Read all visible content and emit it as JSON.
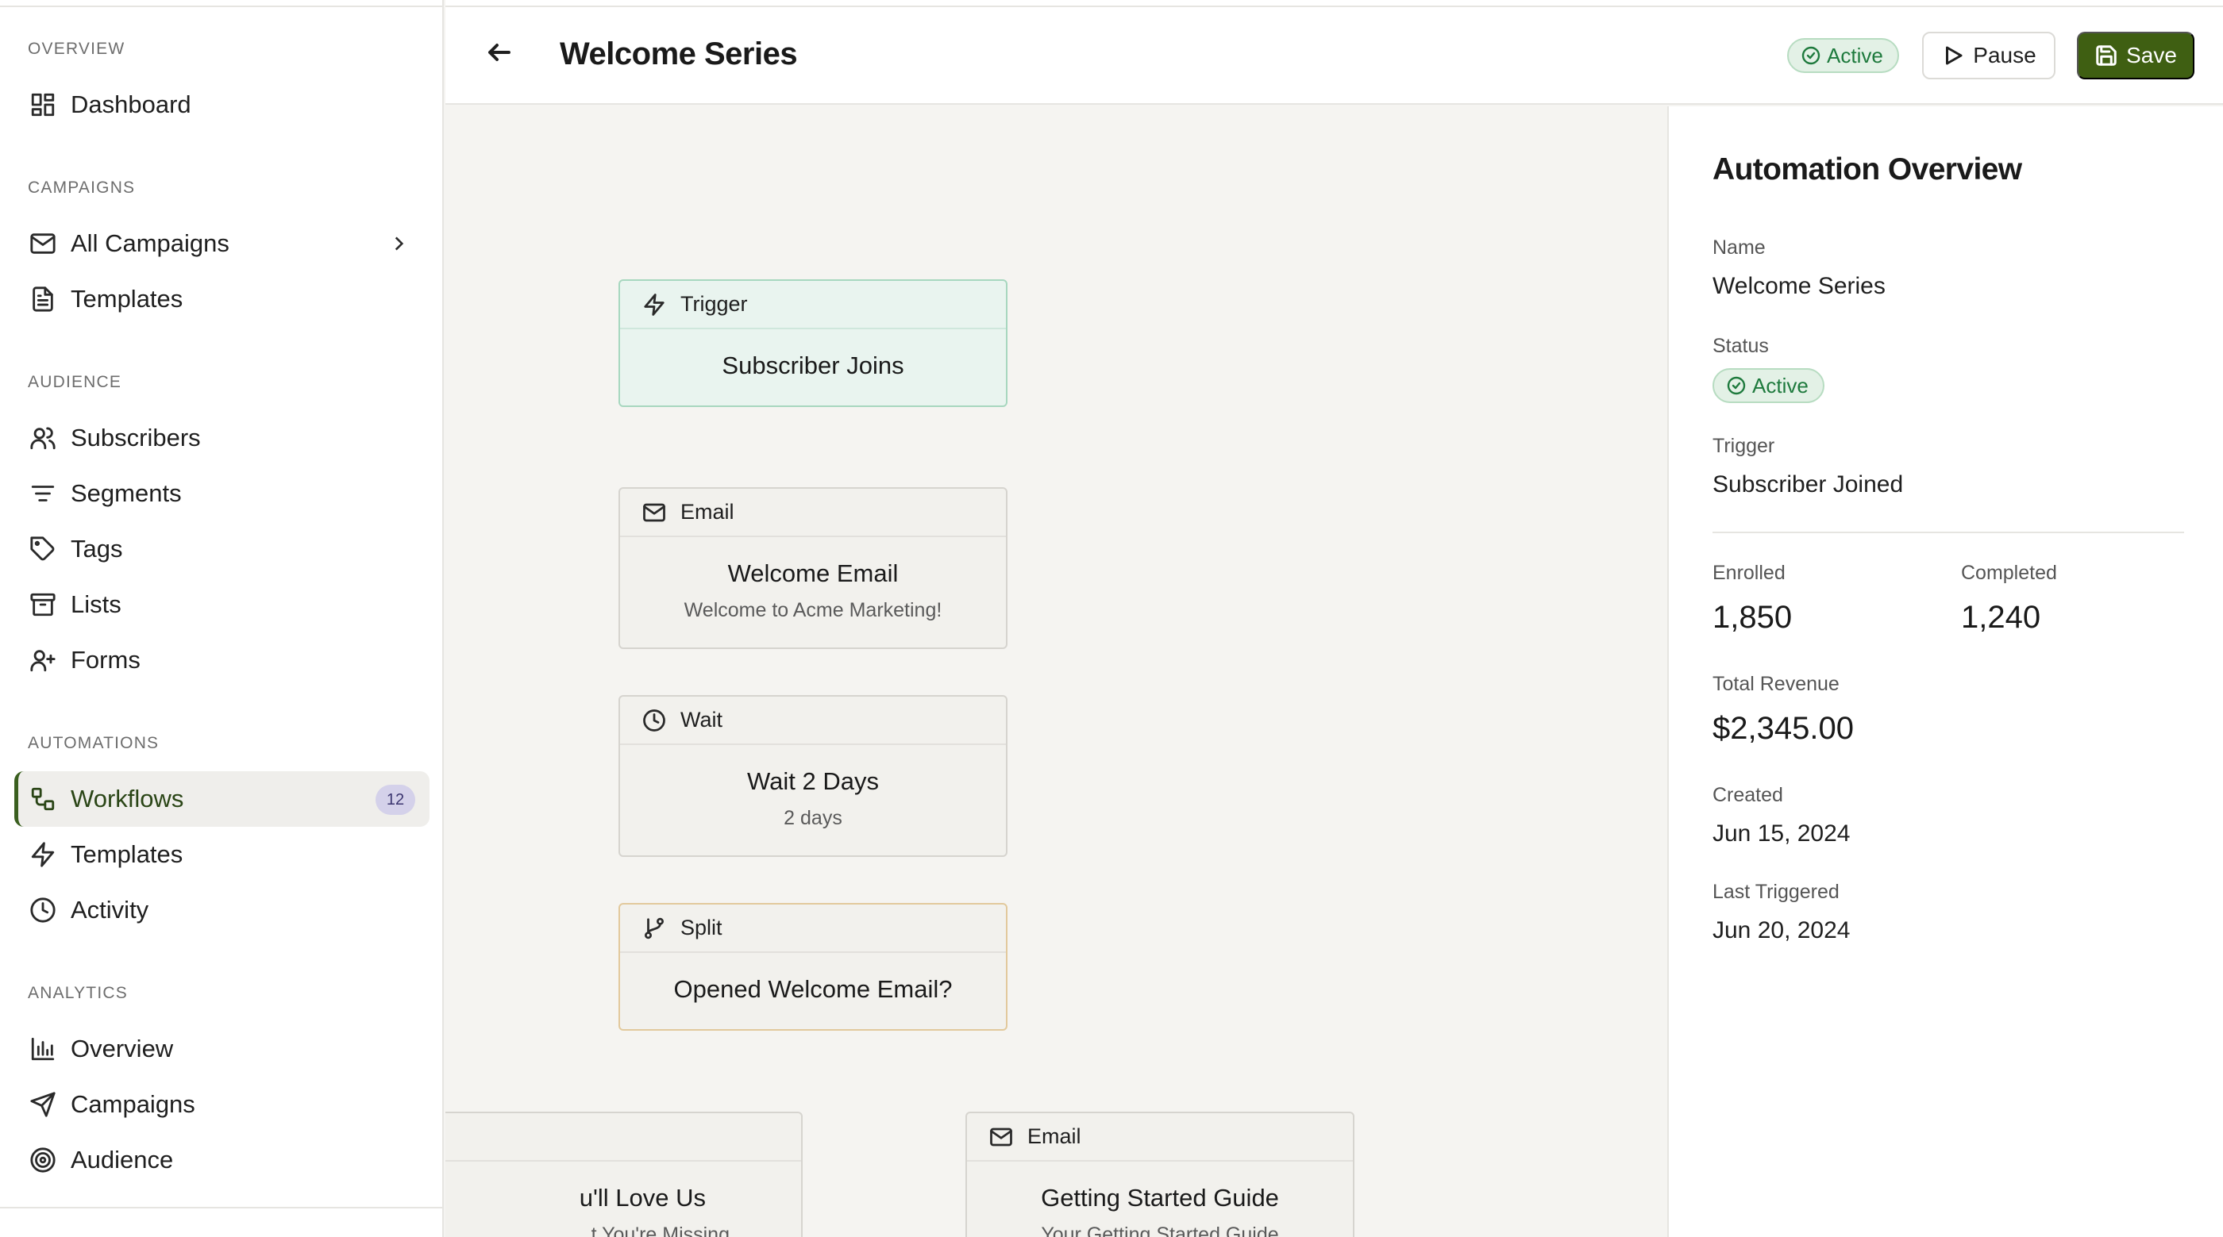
{
  "sidebar": {
    "sections": [
      {
        "label": "OVERVIEW",
        "items": [
          {
            "label": "Dashboard",
            "icon": "dashboard-icon"
          }
        ]
      },
      {
        "label": "CAMPAIGNS",
        "items": [
          {
            "label": "All Campaigns",
            "icon": "mail-icon",
            "has_submenu": true
          },
          {
            "label": "Templates",
            "icon": "document-icon"
          }
        ]
      },
      {
        "label": "AUDIENCE",
        "items": [
          {
            "label": "Subscribers",
            "icon": "users-icon"
          },
          {
            "label": "Segments",
            "icon": "filter-icon"
          },
          {
            "label": "Tags",
            "icon": "tag-icon"
          },
          {
            "label": "Lists",
            "icon": "archive-icon"
          },
          {
            "label": "Forms",
            "icon": "user-plus-icon"
          }
        ]
      },
      {
        "label": "AUTOMATIONS",
        "items": [
          {
            "label": "Workflows",
            "icon": "workflow-icon",
            "active": true,
            "badge": "12"
          },
          {
            "label": "Templates",
            "icon": "zap-icon"
          },
          {
            "label": "Activity",
            "icon": "clock-icon"
          }
        ]
      },
      {
        "label": "ANALYTICS",
        "items": [
          {
            "label": "Overview",
            "icon": "bar-chart-icon"
          },
          {
            "label": "Campaigns",
            "icon": "send-icon"
          },
          {
            "label": "Audience",
            "icon": "target-icon"
          }
        ]
      }
    ]
  },
  "header": {
    "title": "Welcome Series",
    "status": "Active",
    "pause_label": "Pause",
    "save_label": "Save"
  },
  "canvas": {
    "nodes": [
      {
        "type": "Trigger",
        "title": "Subscriber Joins",
        "icon": "zap-icon"
      },
      {
        "type": "Email",
        "title": "Welcome Email",
        "subtitle": "Welcome to Acme Marketing!",
        "icon": "mail-icon"
      },
      {
        "type": "Wait",
        "title": "Wait 2 Days",
        "subtitle": "2 days",
        "icon": "clock-icon"
      },
      {
        "type": "Split",
        "title": "Opened Welcome Email?",
        "icon": "branch-icon"
      },
      {
        "type": "",
        "title": "u'll Love Us",
        "subtitle": "t You're Missing"
      },
      {
        "type": "Email",
        "title": "Getting Started Guide",
        "subtitle": "Your Getting Started Guide",
        "icon": "mail-icon"
      }
    ]
  },
  "overview": {
    "title": "Automation Overview",
    "name_label": "Name",
    "name_value": "Welcome Series",
    "status_label": "Status",
    "status_value": "Active",
    "trigger_label": "Trigger",
    "trigger_value": "Subscriber Joined",
    "enrolled_label": "Enrolled",
    "enrolled_value": "1,850",
    "completed_label": "Completed",
    "completed_value": "1,240",
    "revenue_label": "Total Revenue",
    "revenue_value": "$2,345.00",
    "created_label": "Created",
    "created_value": "Jun 15, 2024",
    "last_triggered_label": "Last Triggered",
    "last_triggered_value": "Jun 20, 2024"
  },
  "colors": {
    "accent": "#3f5f12",
    "active_status": "#1e7a3d",
    "badge_bg": "#d4d1ea"
  }
}
